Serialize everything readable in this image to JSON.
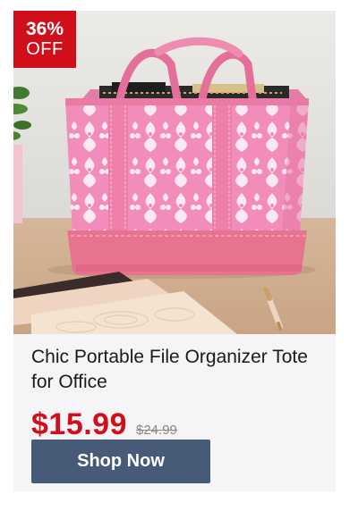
{
  "badge": {
    "percent": "36%",
    "off": "OFF",
    "color": "#d10f1b"
  },
  "product": {
    "title": "Chic Portable File Organizer Tote for Office",
    "price": "$15.99",
    "original_price": "$24.99"
  },
  "cta": {
    "label": "Shop Now",
    "color": "#475a78"
  },
  "colors": {
    "price": "#d10f1b",
    "tote_pink": "#f07fb3",
    "tote_base": "#e8738f"
  }
}
